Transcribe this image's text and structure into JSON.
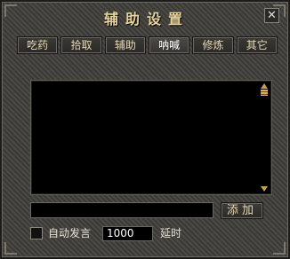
{
  "window": {
    "title": "辅助设置",
    "close_glyph": "✕"
  },
  "tabs": [
    {
      "label": "吃药"
    },
    {
      "label": "拾取"
    },
    {
      "label": "辅助"
    },
    {
      "label": "呐喊",
      "active": true
    },
    {
      "label": "修炼"
    },
    {
      "label": "其它"
    }
  ],
  "message_box": {
    "text": ""
  },
  "message_input": {
    "value": ""
  },
  "add_button": {
    "label": "添加"
  },
  "auto_speak": {
    "label": "自动发言",
    "checked": false
  },
  "delay": {
    "value": "1000",
    "label": "延时"
  },
  "icons": {
    "close": "close-icon",
    "scroll_up": "arrow-up-icon",
    "scroll_down": "arrow-down-icon"
  }
}
